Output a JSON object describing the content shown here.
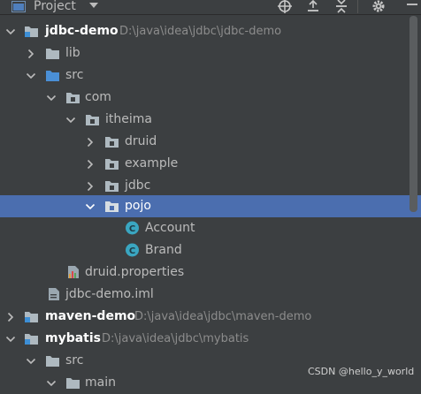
{
  "toolbar": {
    "title": "Project"
  },
  "tree": {
    "rows": [
      {
        "label": "jdbc-demo",
        "path": "D:\\java\\idea\\jdbc\\jdbc-demo"
      },
      {
        "label": "lib"
      },
      {
        "label": "src"
      },
      {
        "label": "com"
      },
      {
        "label": "itheima"
      },
      {
        "label": "druid"
      },
      {
        "label": "example"
      },
      {
        "label": "jdbc"
      },
      {
        "label": "pojo"
      },
      {
        "label": "Account"
      },
      {
        "label": "Brand"
      },
      {
        "label": "druid.properties"
      },
      {
        "label": "jdbc-demo.iml"
      },
      {
        "label": "maven-demo",
        "path": "D:\\java\\idea\\jdbc\\maven-demo"
      },
      {
        "label": "mybatis",
        "path": "D:\\java\\idea\\jdbc\\mybatis"
      },
      {
        "label": "src"
      },
      {
        "label": "main"
      }
    ]
  },
  "watermark": "CSDN @hello_y_world",
  "colors": {
    "background": "#3c3f41",
    "selection": "#4b6eaf",
    "folder": "#aeb9c0",
    "module_dot": "#3d8fd6",
    "class_icon": "#3aa6c1",
    "source_folder": "#4a8fd6"
  }
}
